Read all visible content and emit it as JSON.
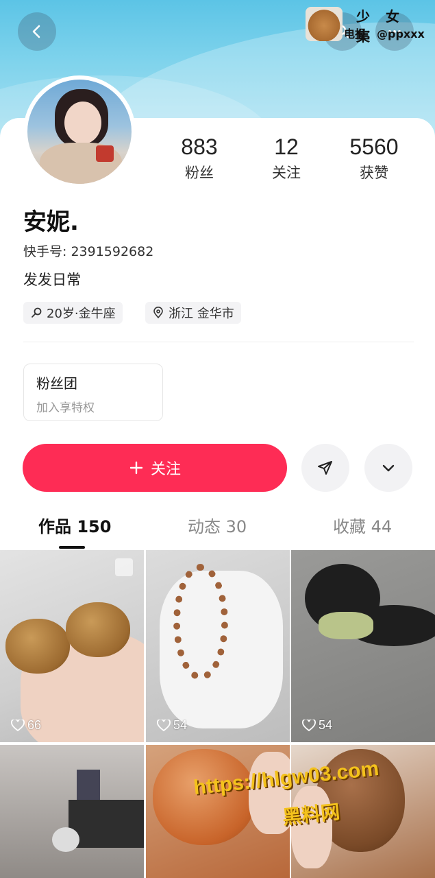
{
  "header": {
    "watermark_title": "少 女 集",
    "watermark_sub": "电报：@ppxxx"
  },
  "profile": {
    "name": "安妮.",
    "uid": "快手号: 2391592682",
    "bio": "发发日常",
    "tags": [
      {
        "icon": "search-key-icon",
        "text": "20岁·金牛座"
      },
      {
        "icon": "location-icon",
        "text": "浙江 金华市"
      }
    ],
    "stats": [
      {
        "value": "883",
        "label": "粉丝"
      },
      {
        "value": "12",
        "label": "关注"
      },
      {
        "value": "5560",
        "label": "获赞"
      }
    ]
  },
  "fanclub": {
    "title": "粉丝团",
    "subtitle": "加入享特权"
  },
  "actions": {
    "follow_label": "关注"
  },
  "tabs": [
    {
      "label": "作品 150",
      "active": true
    },
    {
      "label": "动态 30",
      "active": false
    },
    {
      "label": "收藏 44",
      "active": false
    }
  ],
  "grid": [
    {
      "likes": "66"
    },
    {
      "likes": "54"
    },
    {
      "likes": "54"
    },
    {
      "likes": ""
    },
    {
      "likes": ""
    },
    {
      "likes": ""
    }
  ],
  "overlay": {
    "url_text": "https://hlgw03.com",
    "site_text": "黑料网"
  },
  "colors": {
    "accent": "#fe2c55",
    "sky": "#7fd3ec"
  }
}
